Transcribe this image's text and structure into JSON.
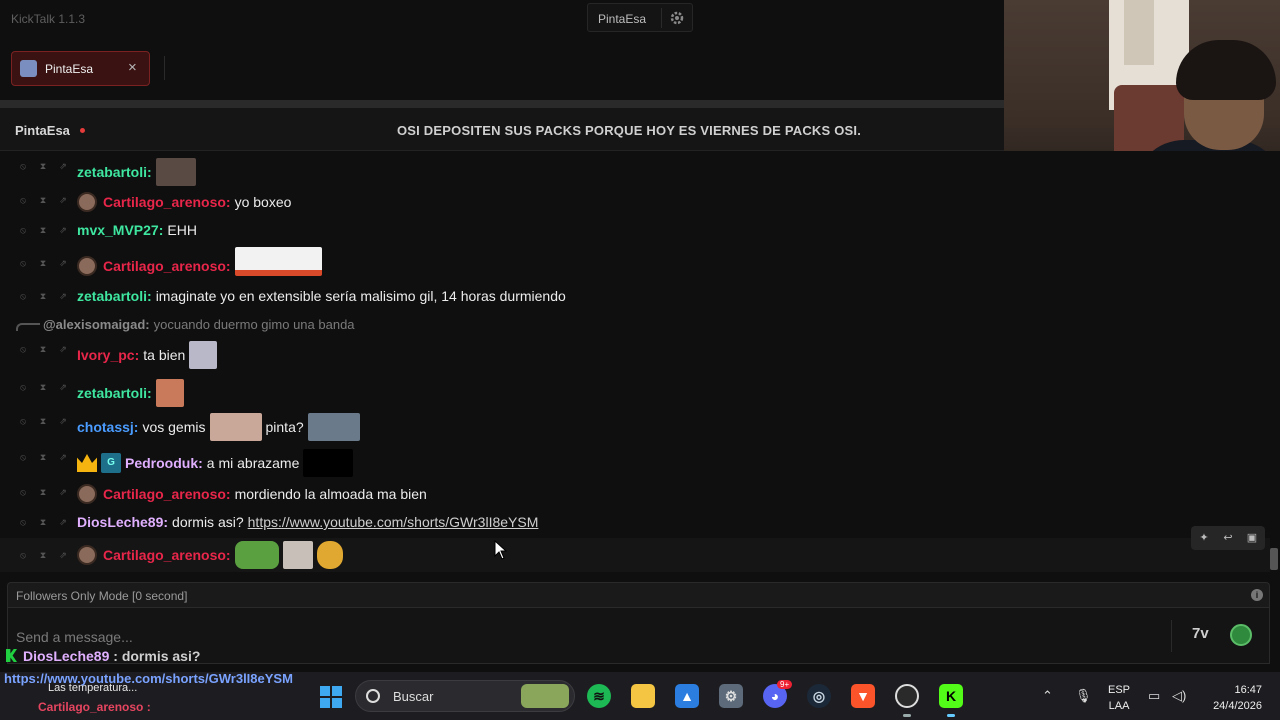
{
  "app": {
    "title": "KickTalk 1.1.3"
  },
  "header": {
    "channel_button": "PintaEsa"
  },
  "tabs": [
    {
      "label": "PintaEsa",
      "close": "×"
    }
  ],
  "chat": {
    "channel": "PintaEsa",
    "stream_title": "OSI DEPOSITEN SUS PACKS PORQUE HOY ES VIERNES DE PACKS OSI.",
    "messages": [
      {
        "user": "zetabartoli:",
        "text": "",
        "color": "#3ee6a0"
      },
      {
        "user": "Cartilago_arenoso:",
        "text": "yo boxeo",
        "color": "#e8264a"
      },
      {
        "user": "mvx_MVP27:",
        "text": "EHH",
        "color": "#3ee6a0"
      },
      {
        "user": "Cartilago_arenoso:",
        "text": "",
        "color": "#e8264a"
      },
      {
        "user": "zetabartoli:",
        "text": "imaginate yo en extensible sería malisimo gil, 14 horas durmiendo",
        "color": "#3ee6a0"
      },
      {
        "reply_user": "@alexisomaigad:",
        "reply_text": "yocuando duermo gimo una banda"
      },
      {
        "user": "Ivory_pc:",
        "text": "ta bien",
        "color": "#e8264a"
      },
      {
        "user": "zetabartoli:",
        "text": "",
        "color": "#3ee6a0"
      },
      {
        "user": "chotassj:",
        "text": "vos gemis",
        "text2": "pinta?",
        "color": "#4a9cff"
      },
      {
        "user": "Pedrooduk:",
        "text": "a mi abrazame",
        "color": "#e0b0ff"
      },
      {
        "user": "Cartilago_arenoso:",
        "text": "mordiendo la almoada ma bien",
        "color": "#e8264a"
      },
      {
        "user": "DiosLeche89:",
        "text": "dormis asi?",
        "link": "https://www.youtube.com/shorts/GWr3lI8eYSM",
        "color": "#e0b0ff"
      },
      {
        "user": "Cartilago_arenoso:",
        "text": "",
        "color": "#e8264a"
      }
    ]
  },
  "composer": {
    "followers_mode": "Followers Only Mode [0 second]",
    "placeholder": "Send a message..."
  },
  "overlay": {
    "user": "DiosLeche89",
    "text": " : dormis asi?",
    "link": "https://www.youtube.com/shorts/GWr3lI8eYSM",
    "user2": "Cartilago_arenoso :"
  },
  "taskbar": {
    "weather": "Las temperatura...",
    "search_label": "Buscar",
    "lang_top": "ESP",
    "lang_bottom": "LAA",
    "time": "16:47",
    "date": "24/4/2026",
    "discord_badge": "9+"
  },
  "colors": {
    "accent": "#53fc18",
    "tab_active": "#7a2222"
  }
}
